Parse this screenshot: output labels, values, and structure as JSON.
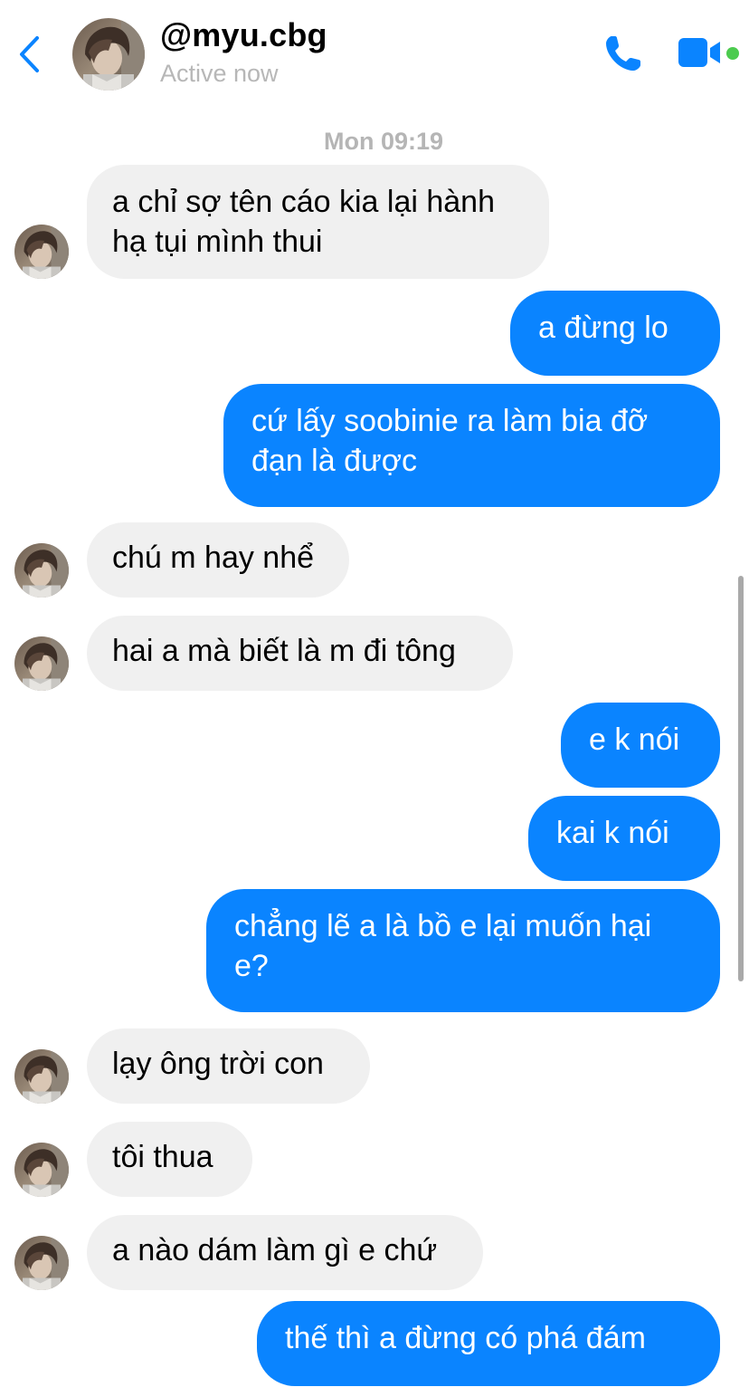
{
  "header": {
    "contact_name": "@myu.cbg",
    "status": "Active now",
    "back_icon": "chevron-left-icon",
    "call_icon": "phone-icon",
    "video_icon": "video-camera-icon",
    "accent_color": "#0a84ff",
    "online_color": "#4ccb4f"
  },
  "conversation": {
    "timestamp": "Mon 09:19",
    "messages": [
      {
        "direction": "in",
        "line1": "a chỉ sợ tên cáo kia lại hành",
        "line2": "hạ tụi mình thui"
      },
      {
        "direction": "out",
        "line1": "a đừng lo"
      },
      {
        "direction": "out",
        "line1": "cứ lấy soobinie ra làm bia đỡ",
        "line2": "đạn là được"
      },
      {
        "direction": "in",
        "line1": "chú m hay nhể"
      },
      {
        "direction": "in",
        "line1": "hai a mà biết là m đi tông"
      },
      {
        "direction": "out",
        "line1": "e k nói"
      },
      {
        "direction": "out",
        "line1": "kai k nói"
      },
      {
        "direction": "out",
        "line1": "chẳng lẽ a là bồ e lại muốn hại",
        "line2": "e?"
      },
      {
        "direction": "in",
        "line1": "lạy ông trời con"
      },
      {
        "direction": "in",
        "line1": "tôi thua"
      },
      {
        "direction": "in",
        "line1": "a nào dám làm gì e chứ"
      },
      {
        "direction": "out",
        "line1": "thế thì a đừng có phá đám"
      }
    ]
  }
}
